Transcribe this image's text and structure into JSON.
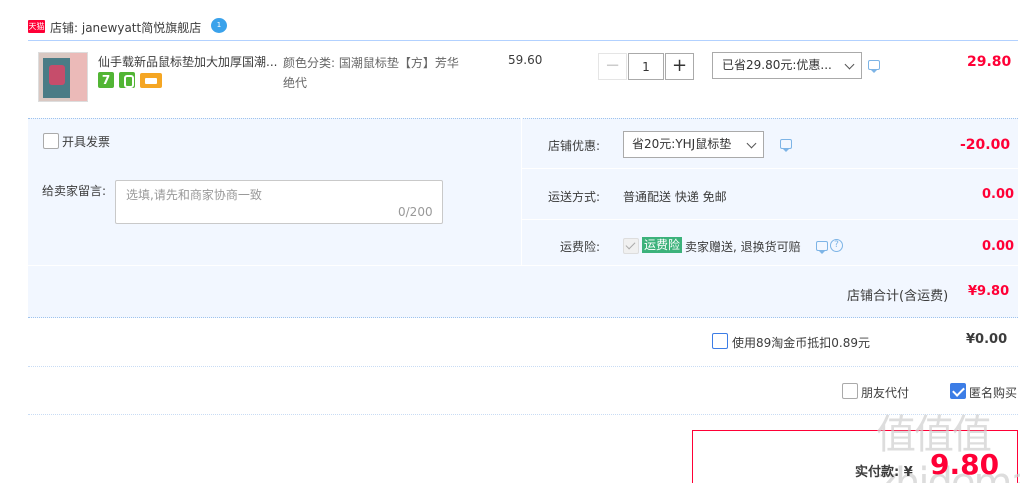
{
  "shop": {
    "badge": "天猫",
    "label": "店铺: janewyatt简悦旗舰店",
    "chat_badge": "1"
  },
  "item": {
    "title": "仙手载新品鼠标垫加大加厚国潮...",
    "icon_7": "7",
    "sku_line1": "颜色分类: 国潮鼠标垫【方】芳华",
    "sku_line2": "绝代",
    "unit_price": "59.60",
    "qty_minus": "−",
    "quantity": "1",
    "qty_plus": "+",
    "promo_selected": "已省29.80元:优惠...",
    "line_total": "29.80"
  },
  "options": {
    "invoice_label": "开具发票",
    "memo_label": "给卖家留言:",
    "memo_placeholder": "选填,请先和商家协商一致",
    "memo_count": "0/200",
    "shop_discount_label": "店铺优惠:",
    "shop_discount_selected": "省20元:YHJ鼠标垫",
    "shop_discount_value": "-20.00",
    "shipping_label": "运送方式:",
    "shipping_method": "普通配送 快递 免邮",
    "shipping_value": "0.00",
    "insurance_label": "运费险:",
    "insurance_tag": "运费险",
    "insurance_desc": "卖家赠送, 退换货可赔",
    "insurance_value": "0.00",
    "help_glyph": "?"
  },
  "totals": {
    "shop_total_label": "店铺合计(含运费)",
    "shop_total": "¥9.80",
    "coin_label": "使用89淘金币抵扣0.89元",
    "coin_value": "¥0.00",
    "friend_pay_label": "朋友代付",
    "anonymous_label": "匿名购买",
    "pay_label": "实付款: ¥",
    "pay_amount": "9.80",
    "watermark": "值值值 zhidemai"
  },
  "colors": {
    "accent": "#ff0036",
    "panel_bg": "#f2f7ff",
    "checkbox_on": "#3c7de6",
    "insurance_tag_bg": "#3cb27b"
  }
}
